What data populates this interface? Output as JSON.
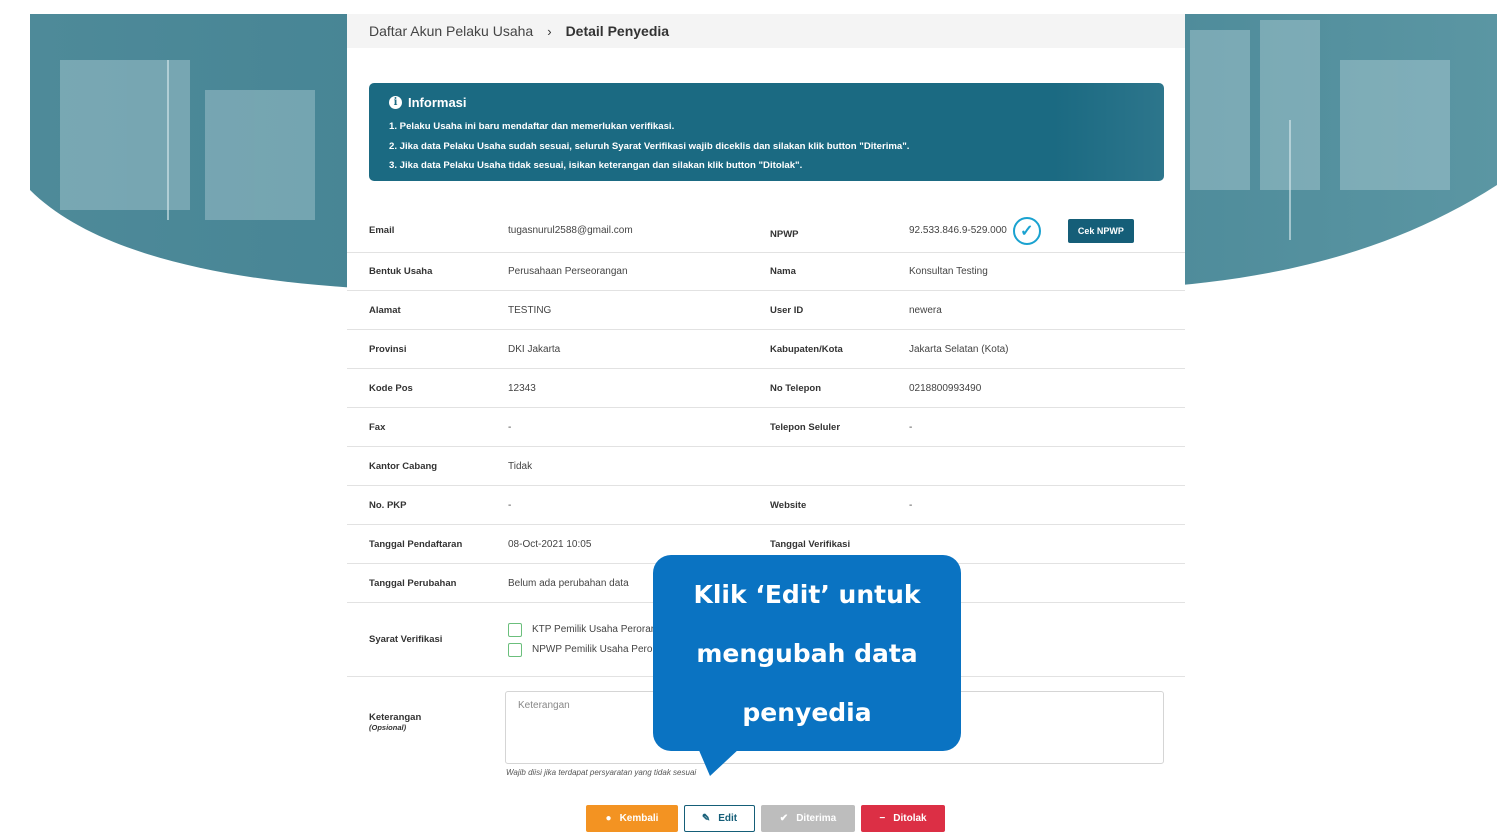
{
  "breadcrumb": {
    "parent": "Daftar Akun Pelaku Usaha",
    "separator": "›",
    "current": "Detail Penyedia"
  },
  "info": {
    "title": "Informasi",
    "lines": [
      "1. Pelaku Usaha ini baru mendaftar dan memerlukan verifikasi.",
      "2. Jika data Pelaku Usaha sudah sesuai, seluruh Syarat Verifikasi wajib diceklis dan silakan klik button \"Diterima\".",
      "3. Jika data Pelaku Usaha tidak sesuai, isikan keterangan dan silakan klik button \"Ditolak\"."
    ]
  },
  "fields": {
    "email": {
      "label": "Email",
      "value": "tugasnurul2588@gmail.com"
    },
    "npwp": {
      "label": "NPWP",
      "value": "92.533.846.9-529.000"
    },
    "cek_npwp": "Cek NPWP",
    "bentuk_usaha": {
      "label": "Bentuk Usaha",
      "value": "Perusahaan Perseorangan"
    },
    "nama": {
      "label": "Nama",
      "value": "Konsultan Testing"
    },
    "alamat": {
      "label": "Alamat",
      "value": "TESTING"
    },
    "user_id": {
      "label": "User ID",
      "value": "newera"
    },
    "provinsi": {
      "label": "Provinsi",
      "value": "DKI Jakarta"
    },
    "kabupaten": {
      "label": "Kabupaten/Kota",
      "value": "Jakarta Selatan (Kota)"
    },
    "kode_pos": {
      "label": "Kode Pos",
      "value": "12343"
    },
    "no_telepon": {
      "label": "No Telepon",
      "value": "0218800993490"
    },
    "fax": {
      "label": "Fax",
      "value": "-"
    },
    "telepon_seluler": {
      "label": "Telepon Seluler",
      "value": "-"
    },
    "kantor_cabang": {
      "label": "Kantor Cabang",
      "value": "Tidak"
    },
    "no_pkp": {
      "label": "No. PKP",
      "value": "-"
    },
    "website": {
      "label": "Website",
      "value": "-"
    },
    "tanggal_pendaftaran": {
      "label": "Tanggal Pendaftaran",
      "value": "08-Oct-2021 10:05"
    },
    "tanggal_verifikasi": {
      "label": "Tanggal Verifikasi",
      "value": ""
    },
    "tanggal_perubahan": {
      "label": "Tanggal Perubahan",
      "value": "Belum ada perubahan data"
    },
    "syarat": {
      "label": "Syarat Verifikasi",
      "items": [
        "KTP Pemilik Usaha Peroran",
        "NPWP Pemilik Usaha Peron"
      ]
    },
    "keterangan": {
      "label": "Keterangan",
      "sub": "(Opsional)",
      "placeholder": "Keterangan",
      "hint": "Wajib diisi jika terdapat persyaratan yang tidak sesuai"
    }
  },
  "buttons": {
    "kembali": "Kembali",
    "edit": "Edit",
    "diterima": "Diterima",
    "ditolak": "Ditolak"
  },
  "callout": {
    "line1": "Klik ‘Edit’ untuk",
    "line2": "mengubah data",
    "line3": "penyedia"
  }
}
